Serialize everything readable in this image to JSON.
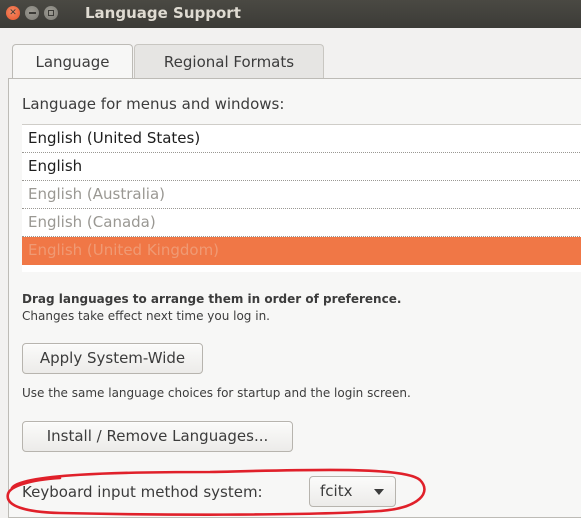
{
  "window": {
    "title": "Language Support",
    "buttons": [
      "close-icon",
      "minimize-icon",
      "maximize-icon"
    ]
  },
  "tabs": [
    {
      "label": "Language",
      "active": true
    },
    {
      "label": "Regional Formats",
      "active": false
    }
  ],
  "language": {
    "section_label": "Language for menus and windows:",
    "items": [
      {
        "label": "English (United States)",
        "state": "strong"
      },
      {
        "label": "English",
        "state": "strong"
      },
      {
        "label": "English (Australia)",
        "state": "dim"
      },
      {
        "label": "English (Canada)",
        "state": "dim"
      },
      {
        "label": "English (United Kingdom)",
        "state": "selected"
      }
    ],
    "hint_bold": "Drag languages to arrange them in order of preference.",
    "hint": "Changes take effect next time you log in."
  },
  "actions": {
    "apply_label": "Apply System-Wide",
    "apply_note": "Use the same language choices for startup and the login screen.",
    "install_label": "Install / Remove Languages..."
  },
  "keyboard": {
    "label": "Keyboard input method system:",
    "selected": "fcitx"
  },
  "colors": {
    "selection": "#f07746",
    "annotation": "#e0202a",
    "titlebar": "#3c3b37"
  }
}
